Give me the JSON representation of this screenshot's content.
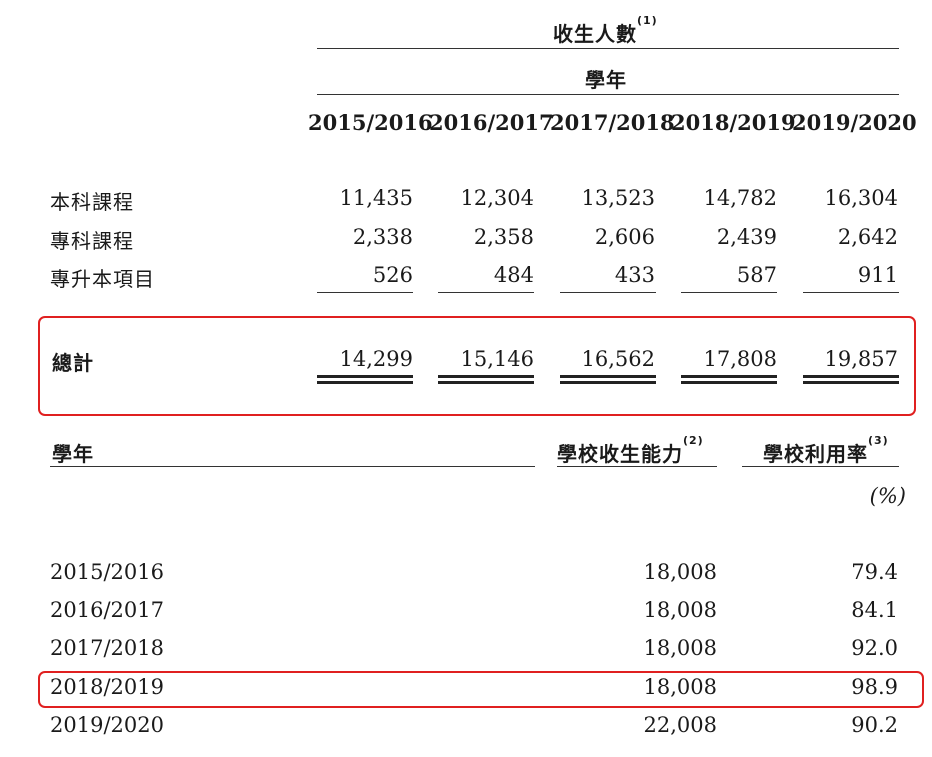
{
  "enrollment": {
    "title": "收生人數",
    "title_note": "(1)",
    "subtitle": "學年",
    "years": [
      "2015/2016",
      "2016/2017",
      "2017/2018",
      "2018/2019",
      "2019/2020"
    ],
    "rows": [
      {
        "label": "本科課程",
        "values": [
          "11,435",
          "12,304",
          "13,523",
          "14,782",
          "16,304"
        ]
      },
      {
        "label": "專科課程",
        "values": [
          "2,338",
          "2,358",
          "2,606",
          "2,439",
          "2,642"
        ]
      },
      {
        "label": "專升本項目",
        "values": [
          "526",
          "484",
          "433",
          "587",
          "911"
        ]
      }
    ],
    "total": {
      "label": "總計",
      "values": [
        "14,299",
        "15,146",
        "16,562",
        "17,808",
        "19,857"
      ]
    }
  },
  "utilization": {
    "col_year": "學年",
    "col_capacity": "學校收生能力",
    "col_capacity_note": "(2)",
    "col_rate": "學校利用率",
    "col_rate_note": "(3)",
    "unit": "(%)",
    "rows": [
      {
        "year": "2015/2016",
        "capacity": "18,008",
        "rate": "79.4"
      },
      {
        "year": "2016/2017",
        "capacity": "18,008",
        "rate": "84.1"
      },
      {
        "year": "2017/2018",
        "capacity": "18,008",
        "rate": "92.0"
      },
      {
        "year": "2018/2019",
        "capacity": "18,008",
        "rate": "98.9"
      },
      {
        "year": "2019/2020",
        "capacity": "22,008",
        "rate": "90.2"
      }
    ]
  }
}
